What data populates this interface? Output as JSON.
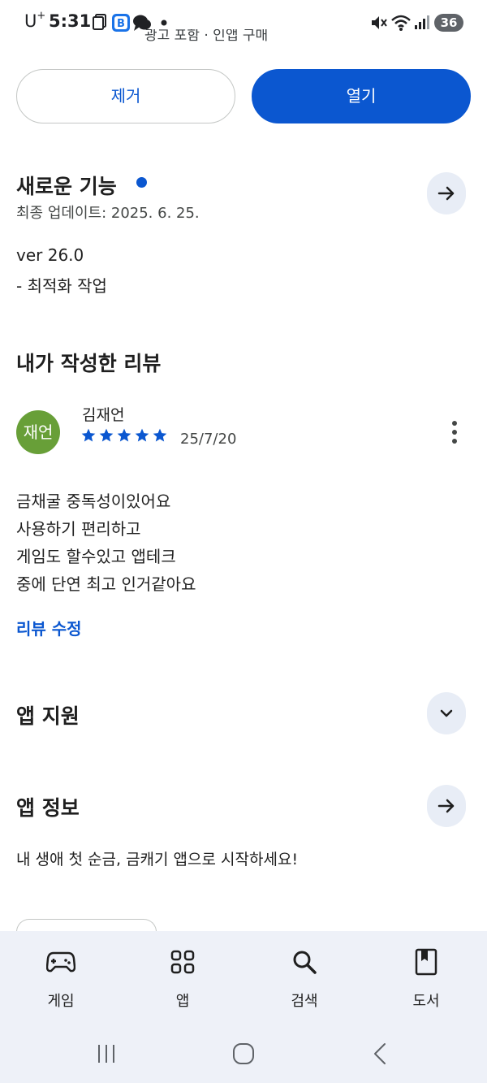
{
  "status_bar": {
    "carrier": "U",
    "carrier_sup": "+",
    "time": "5:31",
    "battery": "36"
  },
  "clipped_header_text": "광고 포함 · 인앱 구매",
  "actions": {
    "remove_label": "제거",
    "open_label": "열기"
  },
  "whats_new": {
    "title": "새로운 기능",
    "updated": "최종 업데이트: 2025. 6. 25.",
    "version": "ver 26.0",
    "note": "- 최적화 작업"
  },
  "my_review": {
    "section_title": "내가 작성한 리뷰",
    "avatar_text": "재언",
    "author": "김재언",
    "rating": 5,
    "date": "25/7/20",
    "lines": [
      "금채굴 중독성이있어요",
      "사용하기 편리하고",
      "게임도 할수있고 앱테크",
      "중에 단연 최고 인거같아요"
    ],
    "edit_label": "리뷰 수정"
  },
  "app_support": {
    "title": "앱 지원"
  },
  "app_info": {
    "title": "앱 정보",
    "description": "내 생애 첫 순금, 금캐기 앱으로 시작하세요!"
  },
  "bottom_nav": {
    "items": [
      {
        "label": "게임",
        "icon": "gamepad-icon"
      },
      {
        "label": "앱",
        "icon": "apps-grid-icon"
      },
      {
        "label": "검색",
        "icon": "search-icon"
      },
      {
        "label": "도서",
        "icon": "book-icon"
      }
    ]
  },
  "colors": {
    "accent": "#0b57d0",
    "avatar_bg": "#689f38",
    "nav_bg": "#eef1f8",
    "round_button_bg": "#e8edf6"
  }
}
